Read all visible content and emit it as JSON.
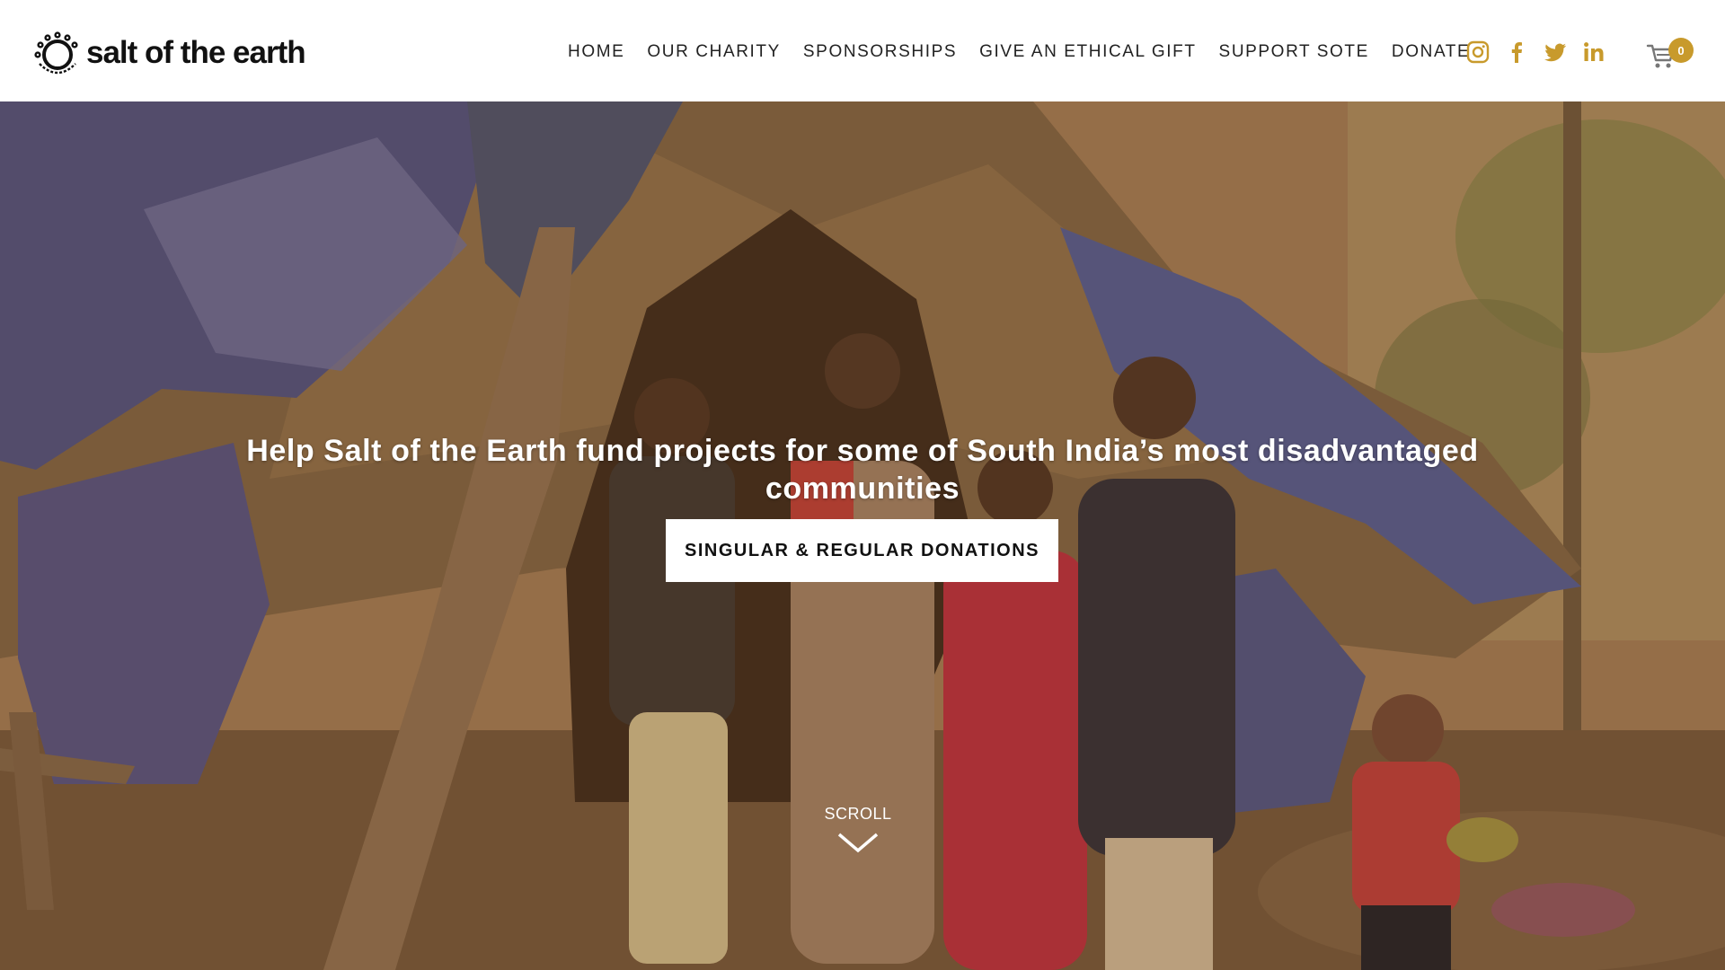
{
  "brand": {
    "name": "salt of the earth",
    "logo_ring_text": "salt of the earth",
    "accent_color": "#c89a2c",
    "icon_color": "#c89a2c"
  },
  "nav": {
    "items": [
      {
        "label": "HOME"
      },
      {
        "label": "OUR CHARITY"
      },
      {
        "label": "SPONSORSHIPS"
      },
      {
        "label": "GIVE AN ETHICAL GIFT"
      },
      {
        "label": "SUPPORT SOTE"
      },
      {
        "label": "DONATE"
      }
    ]
  },
  "socials": [
    {
      "icon": "instagram-icon"
    },
    {
      "icon": "facebook-icon"
    },
    {
      "icon": "twitter-icon"
    },
    {
      "icon": "linkedin-icon"
    }
  ],
  "cart": {
    "icon": "cart-icon",
    "count": "0"
  },
  "hero": {
    "headline": "Help Salt of the Earth fund projects for some of South India’s most disadvantaged communities",
    "cta_label": "SINGULAR & REGULAR DONATIONS",
    "scroll_label": "SCROLL",
    "scroll_icon": "chevron-down-icon"
  }
}
